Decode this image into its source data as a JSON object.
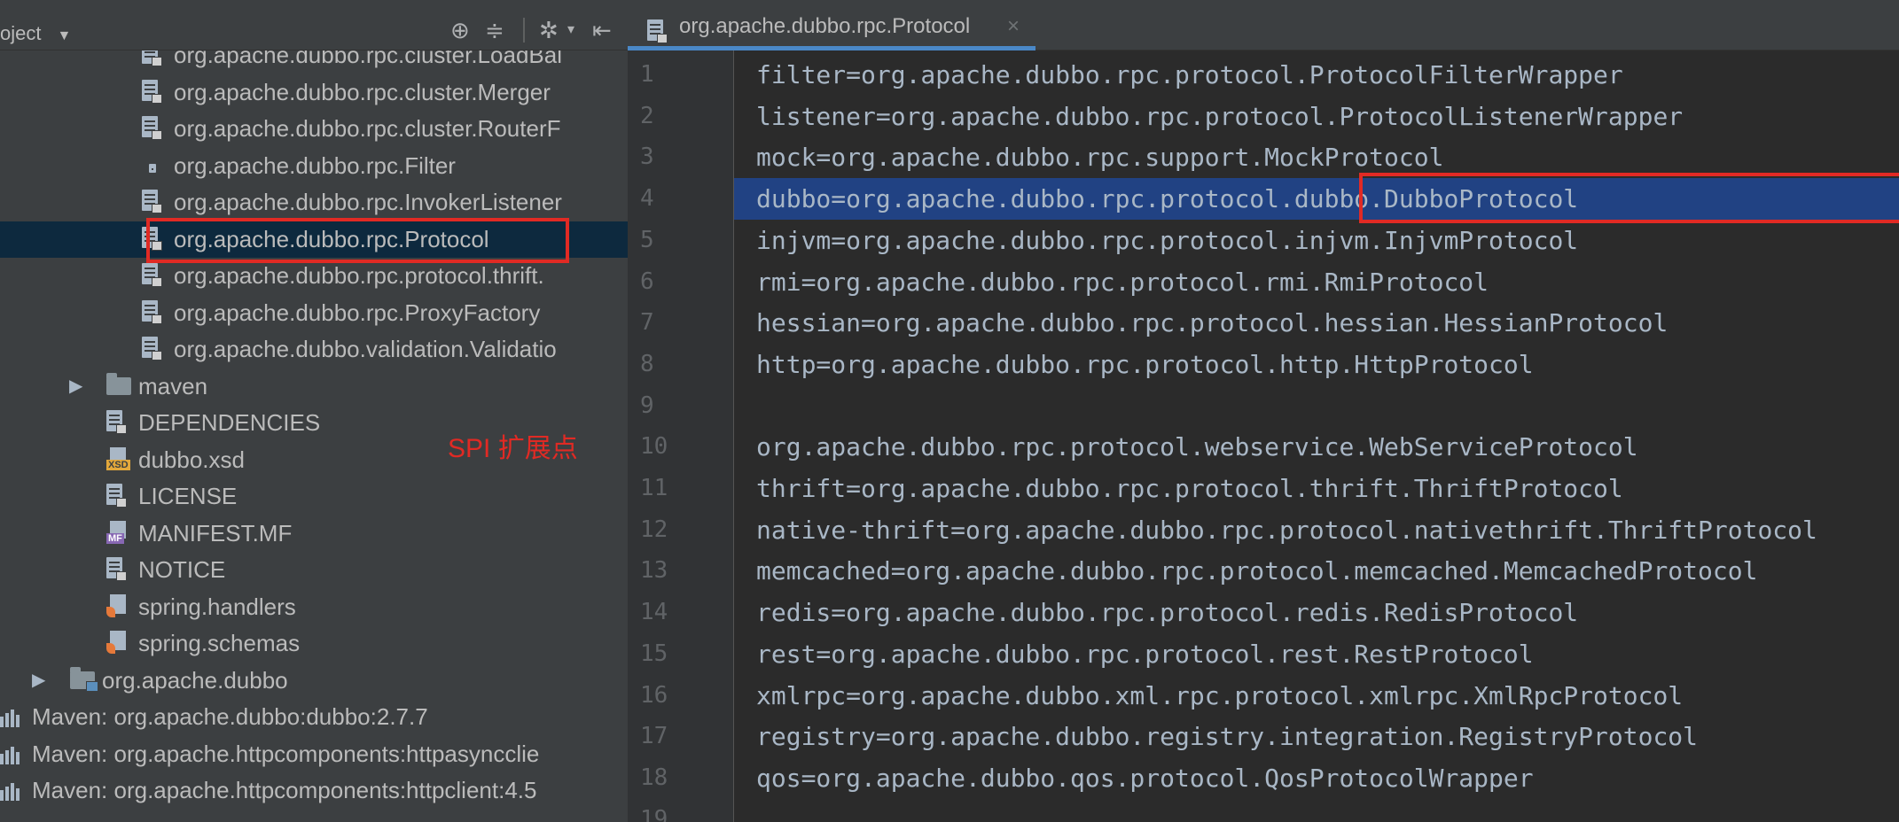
{
  "project_panel": {
    "title": "oject",
    "rows": [
      {
        "label": "org.apache.dubbo.rpc.cluster.LoadBal",
        "icon": "properties-file-icon",
        "indent": 1
      },
      {
        "label": "org.apache.dubbo.rpc.cluster.Merger",
        "icon": "properties-file-icon",
        "indent": 1
      },
      {
        "label": "org.apache.dubbo.rpc.cluster.RouterF",
        "icon": "properties-file-icon",
        "indent": 1
      },
      {
        "label": "org.apache.dubbo.rpc.Filter",
        "icon": "locked-file-icon",
        "indent": 1
      },
      {
        "label": "org.apache.dubbo.rpc.InvokerListener",
        "icon": "properties-file-icon",
        "indent": 1
      },
      {
        "label": "org.apache.dubbo.rpc.Protocol",
        "icon": "properties-file-icon",
        "indent": 1,
        "selected": true
      },
      {
        "label": "org.apache.dubbo.rpc.protocol.thrift.",
        "icon": "properties-file-icon",
        "indent": 1
      },
      {
        "label": "org.apache.dubbo.rpc.ProxyFactory",
        "icon": "properties-file-icon",
        "indent": 1
      },
      {
        "label": "org.apache.dubbo.validation.Validatio",
        "icon": "properties-file-icon",
        "indent": 1
      },
      {
        "label": "maven",
        "icon": "folder-icon",
        "indent": 0,
        "expandable": true
      },
      {
        "label": "DEPENDENCIES",
        "icon": "text-file-icon",
        "indent": 0
      },
      {
        "label": "dubbo.xsd",
        "icon": "xsd-file-icon",
        "indent": 0
      },
      {
        "label": "LICENSE",
        "icon": "text-file-icon",
        "indent": 0
      },
      {
        "label": "MANIFEST.MF",
        "icon": "manifest-file-icon",
        "indent": 0
      },
      {
        "label": "NOTICE",
        "icon": "text-file-icon",
        "indent": 0
      },
      {
        "label": "spring.handlers",
        "icon": "spring-file-icon",
        "indent": 0
      },
      {
        "label": "spring.schemas",
        "icon": "spring-file-icon",
        "indent": 0
      },
      {
        "label": "org.apache.dubbo",
        "icon": "package-folder-icon",
        "indent": -1,
        "expandable": true
      },
      {
        "label": "Maven: org.apache.dubbo:dubbo:2.7.7",
        "icon": "library-icon",
        "indent": -2
      },
      {
        "label": "Maven: org.apache.httpcomponents:httpasyncclie",
        "icon": "library-icon",
        "indent": -2
      },
      {
        "label": "Maven: org.apache.httpcomponents:httpclient:4.5",
        "icon": "library-icon",
        "indent": -2
      }
    ]
  },
  "annotation": {
    "spi_label": "SPI 扩展点"
  },
  "editor": {
    "tab_label": "org.apache.dubbo.rpc.Protocol",
    "highlighted_line": 4,
    "lines": [
      "filter=org.apache.dubbo.rpc.protocol.ProtocolFilterWrapper",
      "listener=org.apache.dubbo.rpc.protocol.ProtocolListenerWrapper",
      "mock=org.apache.dubbo.rpc.support.MockProtocol",
      "dubbo=org.apache.dubbo.rpc.protocol.dubbo.DubboProtocol",
      "injvm=org.apache.dubbo.rpc.protocol.injvm.InjvmProtocol",
      "rmi=org.apache.dubbo.rpc.protocol.rmi.RmiProtocol",
      "hessian=org.apache.dubbo.rpc.protocol.hessian.HessianProtocol",
      "http=org.apache.dubbo.rpc.protocol.http.HttpProtocol",
      "",
      "org.apache.dubbo.rpc.protocol.webservice.WebServiceProtocol",
      "thrift=org.apache.dubbo.rpc.protocol.thrift.ThriftProtocol",
      "native-thrift=org.apache.dubbo.rpc.protocol.nativethrift.ThriftProtocol",
      "memcached=org.apache.dubbo.rpc.protocol.memcached.MemcachedProtocol",
      "redis=org.apache.dubbo.rpc.protocol.redis.RedisProtocol",
      "rest=org.apache.dubbo.rpc.protocol.rest.RestProtocol",
      "xmlrpc=org.apache.dubbo.xml.rpc.protocol.xmlrpc.XmlRpcProtocol",
      "registry=org.apache.dubbo.registry.integration.RegistryProtocol",
      "qos=org.apache.dubbo.qos.protocol.QosProtocolWrapper",
      ""
    ]
  },
  "colors": {
    "annotation_red": "#e12a24",
    "selection_blue": "#214283",
    "tab_underline": "#4a88c7"
  }
}
